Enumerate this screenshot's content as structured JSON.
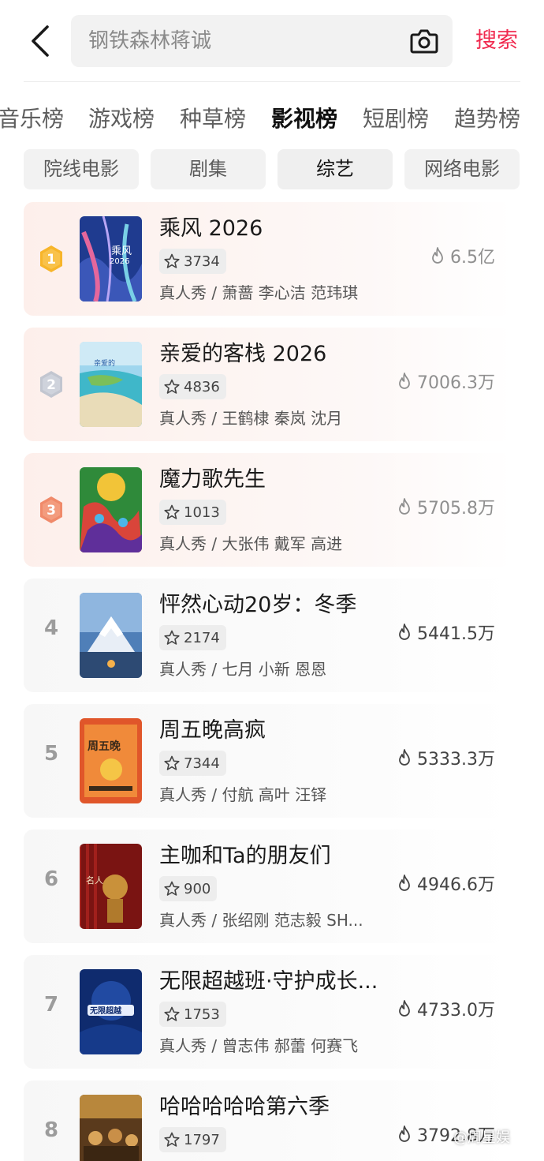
{
  "search": {
    "query": "钢铁森林蒋诚",
    "button": "搜索"
  },
  "tabs": [
    "音乐榜",
    "游戏榜",
    "种草榜",
    "影视榜",
    "短剧榜",
    "趋势榜"
  ],
  "subcats": [
    "院线电影",
    "剧集",
    "综艺",
    "网络电影"
  ],
  "items": [
    {
      "rank": "1",
      "title": "乘风 2026",
      "rating": "3734",
      "meta": "真人秀 / 萧蔷 李心洁 范玮琪",
      "heat": "6.5亿"
    },
    {
      "rank": "2",
      "title": "亲爱的客栈 2026",
      "rating": "4836",
      "meta": "真人秀 / 王鹤棣 秦岚 沈月",
      "heat": "7006.3万"
    },
    {
      "rank": "3",
      "title": "魔力歌先生",
      "rating": "1013",
      "meta": "真人秀 / 大张伟 戴军 高进",
      "heat": "5705.8万"
    },
    {
      "rank": "4",
      "title": "怦然心动20岁：冬季",
      "rating": "2174",
      "meta": "真人秀 / 七月 小新 恩恩",
      "heat": "5441.5万"
    },
    {
      "rank": "5",
      "title": "周五晚高疯",
      "rating": "7344",
      "meta": "真人秀 / 付航 高叶 汪铎",
      "heat": "5333.3万"
    },
    {
      "rank": "6",
      "title": "主咖和Ta的朋友们",
      "rating": "900",
      "meta": "真人秀 / 张绍刚 范志毅 SH...",
      "heat": "4946.6万"
    },
    {
      "rank": "7",
      "title": "无限超越班·守护成长...",
      "rating": "1753",
      "meta": "真人秀 / 曾志伟 郝蕾 何赛飞",
      "heat": "4733.0万"
    },
    {
      "rank": "8",
      "title": "哈哈哈哈哈第六季",
      "rating": "1797",
      "meta": "",
      "heat": "3792.8万"
    }
  ],
  "watermark": "@周星娱",
  "icons": {
    "back": "chevron-left-icon",
    "camera": "camera-icon",
    "star": "star-icon",
    "flame": "flame-icon"
  },
  "colors": {
    "accent": "#f0294e",
    "gold": "#f7b52a",
    "silver": "#c2c6d0",
    "bronze": "#f08a6a"
  }
}
